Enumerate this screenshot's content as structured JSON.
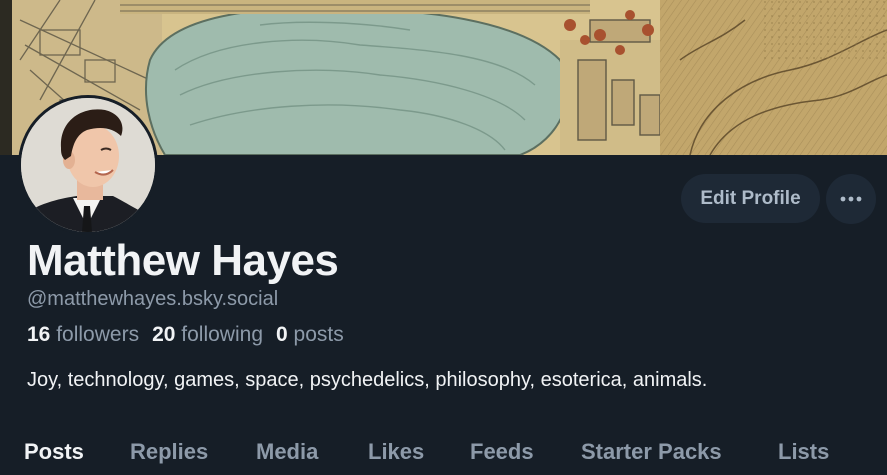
{
  "profile": {
    "display_name": "Matthew Hayes",
    "handle": "@matthewhayes.bsky.social",
    "bio": "Joy, technology, games, space, psychedelics, philosophy, esoterica, animals.",
    "stats": {
      "followers_count": "16",
      "followers_label": "followers",
      "following_count": "20",
      "following_label": "following",
      "posts_count": "0",
      "posts_label": "posts"
    }
  },
  "actions": {
    "edit_profile_label": "Edit Profile",
    "more_icon": "ellipsis-icon"
  },
  "tabs": [
    {
      "label": "Posts",
      "active": true
    },
    {
      "label": "Replies",
      "active": false
    },
    {
      "label": "Media",
      "active": false
    },
    {
      "label": "Likes",
      "active": false
    },
    {
      "label": "Feeds",
      "active": false
    },
    {
      "label": "Starter Packs",
      "active": false
    },
    {
      "label": "Lists",
      "active": false
    }
  ],
  "colors": {
    "background": "#161e27",
    "primary_text": "#f1f3f5",
    "secondary_text": "#8d9aa9",
    "button_bg": "#1e2936"
  }
}
